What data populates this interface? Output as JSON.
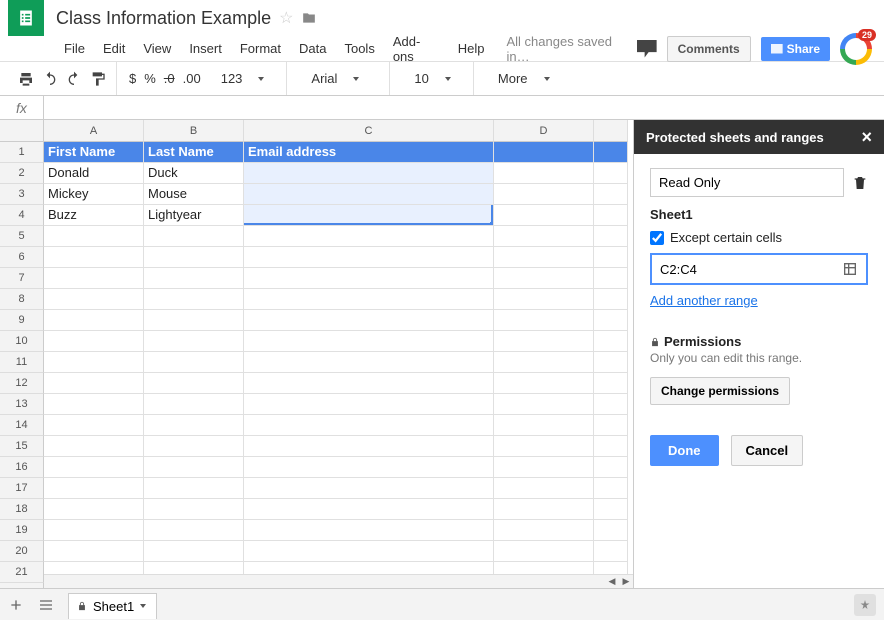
{
  "doc": {
    "title": "Class Information Example",
    "save_status": "All changes saved in…"
  },
  "menu": {
    "file": "File",
    "edit": "Edit",
    "view": "View",
    "insert": "Insert",
    "format": "Format",
    "data": "Data",
    "tools": "Tools",
    "addons": "Add-ons",
    "help": "Help"
  },
  "menubar_buttons": {
    "comments": "Comments",
    "share": "Share"
  },
  "avatar_badge": "29",
  "toolbar": {
    "currency": "$",
    "percent": "%",
    "dec_dec": ".0",
    "inc_dec": ".00",
    "num": "123",
    "font": "Arial",
    "size": "10",
    "more": "More"
  },
  "fx_label": "fx",
  "columns": [
    "A",
    "B",
    "C",
    "D",
    ""
  ],
  "row_count": 22,
  "header_row": {
    "a": "First Name",
    "b": "Last Name",
    "c": "Email address"
  },
  "rows": [
    {
      "a": "Donald",
      "b": "Duck",
      "c": ""
    },
    {
      "a": "Mickey",
      "b": "Mouse",
      "c": ""
    },
    {
      "a": "Buzz",
      "b": "Lightyear",
      "c": ""
    }
  ],
  "panel": {
    "title": "Protected sheets and ranges",
    "description": "Read Only",
    "sheet": "Sheet1",
    "except_label": "Except certain cells",
    "except_checked": true,
    "range": "C2:C4",
    "add_range": "Add another range",
    "perm_title": "Permissions",
    "perm_sub": "Only you can edit this range.",
    "change": "Change permissions",
    "done": "Done",
    "cancel": "Cancel"
  },
  "tabs": {
    "sheet": "Sheet1"
  }
}
